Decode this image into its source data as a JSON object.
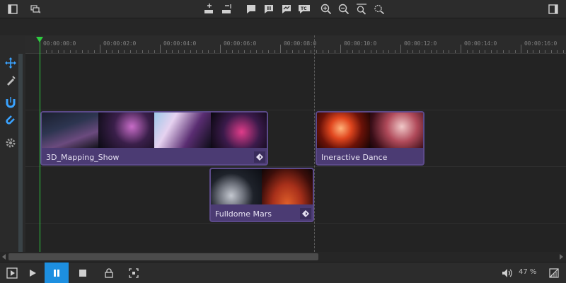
{
  "toolbar": {
    "icons": [
      "sidebar-left-icon",
      "layers-icon",
      "track-add-icon",
      "track-remove-icon",
      "flag-icon",
      "split-icon",
      "image-marker-icon",
      "timecode-icon",
      "zoom-in-icon",
      "zoom-out-icon",
      "zoom-fit-icon",
      "zoom-reset-icon",
      "sidebar-right-icon"
    ]
  },
  "tools": [
    "move-icon",
    "razor-icon",
    "snap-magnet-icon",
    "magnet-icon",
    "settings-icon"
  ],
  "ruler": {
    "labels": [
      "00:00:00:0",
      "00:00:02:0",
      "00:00:04:0",
      "00:00:06:0",
      "00:00:08:0",
      "00:00:10:0",
      "00:00:12:0",
      "00:00:14:0",
      "00:00:16:0"
    ]
  },
  "clips": [
    {
      "name": "3D_Mapping_Show",
      "track": 1,
      "start_sec": 0.0,
      "end_sec": 7.6
    },
    {
      "name": "Ineractive Dance",
      "track": 1,
      "start_sec": 9.2,
      "end_sec": 12.7
    },
    {
      "name": "Fulldome Mars",
      "track": 2,
      "start_sec": 5.8,
      "end_sec": 9.2
    }
  ],
  "playhead_sec": 0.0,
  "marker_sec": 9.2,
  "bottom": {
    "icons": [
      "play-mode-icon",
      "play-icon",
      "pause-icon",
      "stop-icon",
      "lock-icon",
      "fullscreen-icon",
      "volume-icon",
      "aspect-icon"
    ],
    "zoom_label": "47 %"
  },
  "colors": {
    "accent": "#1d8fe0",
    "playhead": "#2ecc40",
    "clip": "#4b3b73"
  }
}
